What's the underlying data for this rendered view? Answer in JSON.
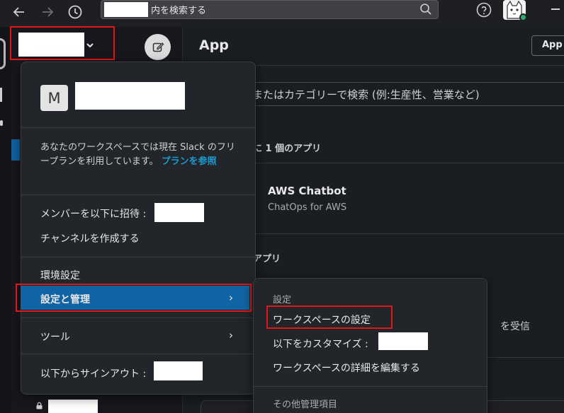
{
  "topbar": {
    "search_text": "内を検索する",
    "back_icon": "arrow-left-icon",
    "forward_icon": "arrow-right-icon",
    "history_icon": "clock-icon",
    "search_icon": "magnifier-icon",
    "help_icon": "question-circle-icon"
  },
  "sidebar": {
    "compose_icon": "pencil-square-icon"
  },
  "main": {
    "title": "App",
    "app_button": "App",
    "search_placeholder": "またはカテゴリーで検索 (例:生産性、営業など)",
    "section_installed": "に 1 個のアプリ",
    "app_name": "AWS Chatbot",
    "app_desc": "ChatOps for AWS",
    "section_other": "アプリ",
    "partial_text": "を受信"
  },
  "menu": {
    "avatar_letter": "M",
    "plan_text": "あなたのワークスペースでは現在 Slack のフリープランを利用しています。",
    "plan_link": "プランを参照",
    "invite": "メンバーを以下に招待 :",
    "create_channel": "チャンネルを作成する",
    "preferences": "環境設定",
    "settings_admin": "設定と管理",
    "tools": "ツール",
    "signout": "以下からサインアウト :",
    "chevron": "›"
  },
  "submenu": {
    "heading_settings": "設定",
    "workspace_settings": "ワークスペースの設定",
    "customize": "以下をカスタマイズ :",
    "edit_details": "ワークスペースの詳細を編集する",
    "heading_other": "その他管理項目"
  },
  "colors": {
    "accent": "#1164a3",
    "link": "#1d9bd1",
    "highlight_border": "#e0171a",
    "presence": "#2bac76"
  }
}
